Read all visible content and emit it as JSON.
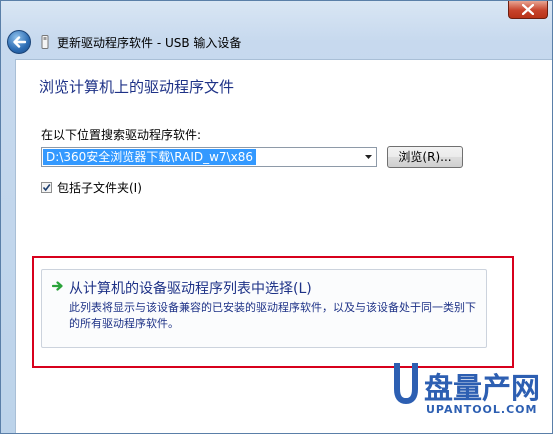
{
  "window": {
    "title": "更新驱动程序软件 - USB 输入设备"
  },
  "main": {
    "heading": "浏览计算机上的驱动程序文件",
    "search_label": "在以下位置搜索驱动程序软件:",
    "path_value": "D:\\360安全浏览器下载\\RAID_w7\\x86",
    "browse_label": "浏览(R)...",
    "include_subfolders_label": "包括子文件夹(I)",
    "include_subfolders_checked": true
  },
  "option": {
    "title": "从计算机的设备驱动程序列表中选择(L)",
    "description": "此列表将显示与该设备兼容的已安装的驱动程序软件，以及与该设备处于同一类别下的所有驱动程序软件。"
  },
  "watermark": {
    "brand_cn": "盘量产网",
    "brand_en": "UPANTOOL.COM"
  },
  "colors": {
    "heading": "#1e3287",
    "highlight_border": "#d7001c",
    "selection": "#3399ff",
    "option_arrow": "#2aa33a"
  }
}
